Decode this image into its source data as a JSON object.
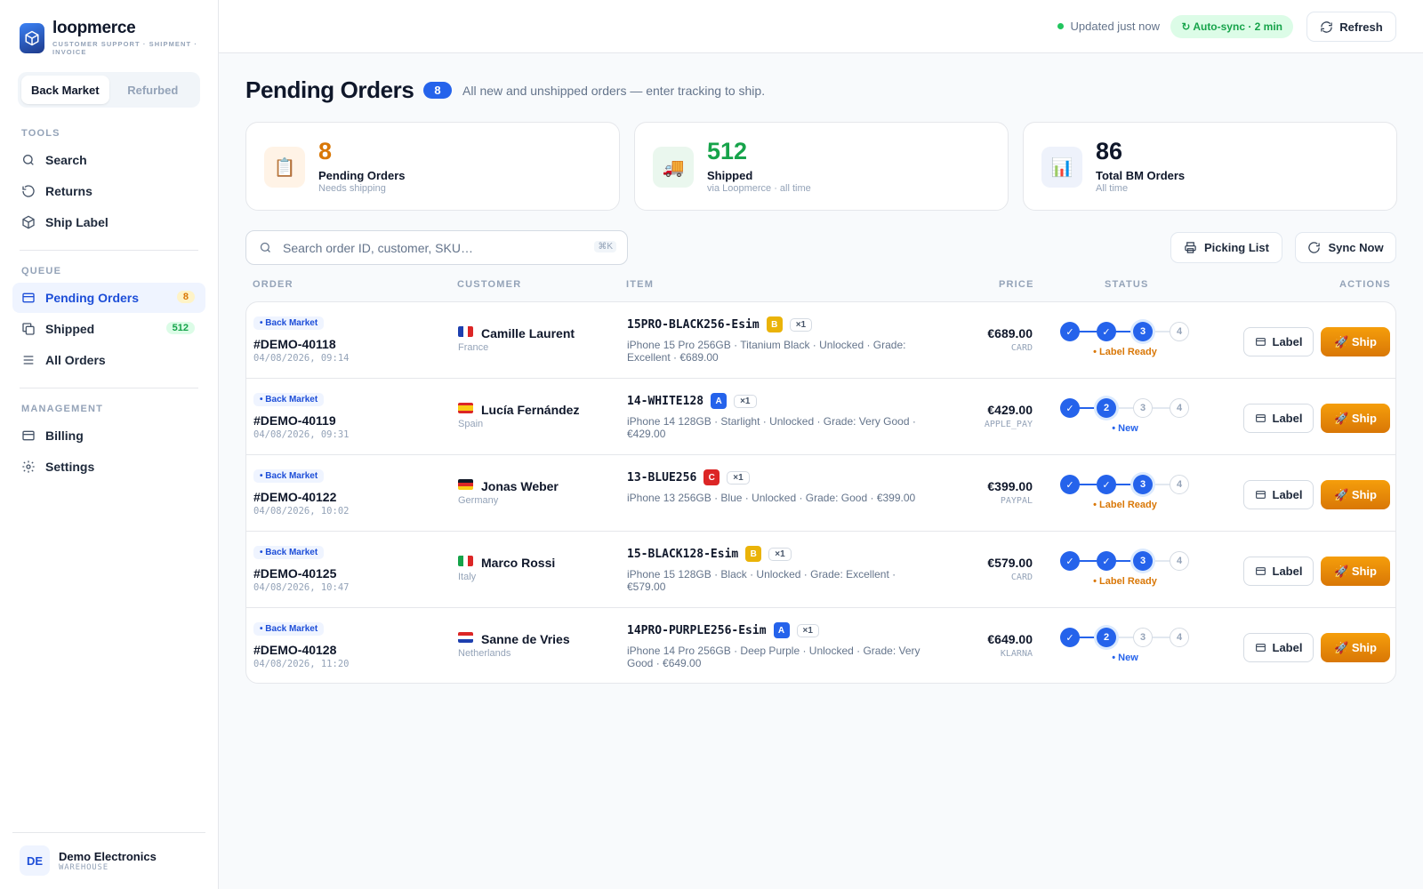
{
  "brand": {
    "name": "loopmerce",
    "subtitle": "CUSTOMER SUPPORT · SHIPMENT · INVOICE"
  },
  "marketplace_tabs": [
    {
      "label": "Back Market",
      "active": true
    },
    {
      "label": "Refurbed",
      "active": false
    }
  ],
  "sidebar": {
    "tools_heading": "TOOLS",
    "tools": [
      {
        "label": "Search",
        "icon": "search-icon"
      },
      {
        "label": "Returns",
        "icon": "returns-icon"
      },
      {
        "label": "Ship Label",
        "icon": "box-icon"
      }
    ],
    "queue_heading": "QUEUE",
    "queue": [
      {
        "label": "Pending Orders",
        "icon": "card-icon",
        "badge": "8",
        "active": true
      },
      {
        "label": "Shipped",
        "icon": "copy-icon",
        "badge": "512",
        "active": false
      },
      {
        "label": "All Orders",
        "icon": "list-icon",
        "badge": "",
        "active": false
      }
    ],
    "management_heading": "MANAGEMENT",
    "management": [
      {
        "label": "Billing",
        "icon": "billing-icon"
      },
      {
        "label": "Settings",
        "icon": "gear-icon"
      }
    ],
    "user": {
      "initials": "DE",
      "name": "Demo Electronics",
      "role": "WAREHOUSE"
    }
  },
  "topbar": {
    "updated": "Updated just now",
    "autosync": "↻ Auto-sync · 2 min",
    "refresh_label": "Refresh"
  },
  "page": {
    "title": "Pending Orders",
    "count": "8",
    "subtitle": "All new and unshipped orders — enter tracking to ship."
  },
  "stats": [
    {
      "value": "8",
      "label": "Pending Orders",
      "sub": "Needs shipping",
      "icon": "clipboard-icon",
      "glyph": "📋",
      "color": "#d97706",
      "bg": "#fff3e6"
    },
    {
      "value": "512",
      "label": "Shipped",
      "sub": "via Loopmerce · all time",
      "icon": "truck-icon",
      "glyph": "🚚",
      "color": "#16a34a",
      "bg": "#eaf7ee"
    },
    {
      "value": "86",
      "label": "Total BM Orders",
      "sub": "All time",
      "icon": "chart-icon",
      "glyph": "📊",
      "color": "#0f172a",
      "bg": "#eef2fb"
    }
  ],
  "search": {
    "placeholder": "Search order ID, customer, SKU…",
    "shortcut": "⌘K"
  },
  "toolbar": {
    "picking_list": "Picking List",
    "sync_now": "Sync Now"
  },
  "table": {
    "headers": {
      "order": "ORDER",
      "customer": "CUSTOMER",
      "item": "ITEM",
      "price": "PRICE",
      "status": "STATUS",
      "actions": "ACTIONS"
    },
    "label_btn": "Label",
    "ship_btn": "🚀 Ship",
    "rows": [
      {
        "market": "• Back Market",
        "id": "#DEMO-40118",
        "date": "04/08/2026, 09:14",
        "flag": "FR",
        "customer": "Camille Laurent",
        "country": "France",
        "sku": "15PRO-BLACK256-Esim",
        "grade": "B",
        "qty": "×1",
        "desc": "iPhone 15 Pro 256GB · Titanium Black · Unlocked · Grade: Excellent · €689.00",
        "price": "€689.00",
        "payment": "CARD",
        "step": 3,
        "status": "• Label Ready",
        "status_type": "orange"
      },
      {
        "market": "• Back Market",
        "id": "#DEMO-40119",
        "date": "04/08/2026, 09:31",
        "flag": "ES",
        "customer": "Lucía Fernández",
        "country": "Spain",
        "sku": "14-WHITE128",
        "grade": "A",
        "qty": "×1",
        "desc": "iPhone 14 128GB · Starlight · Unlocked · Grade: Very Good · €429.00",
        "price": "€429.00",
        "payment": "APPLE_PAY",
        "step": 2,
        "status": "• New",
        "status_type": "blue"
      },
      {
        "market": "• Back Market",
        "id": "#DEMO-40122",
        "date": "04/08/2026, 10:02",
        "flag": "DE",
        "customer": "Jonas Weber",
        "country": "Germany",
        "sku": "13-BLUE256",
        "grade": "C",
        "qty": "×1",
        "desc": "iPhone 13 256GB · Blue · Unlocked · Grade: Good · €399.00",
        "price": "€399.00",
        "payment": "PAYPAL",
        "step": 3,
        "status": "• Label Ready",
        "status_type": "orange"
      },
      {
        "market": "• Back Market",
        "id": "#DEMO-40125",
        "date": "04/08/2026, 10:47",
        "flag": "IT",
        "customer": "Marco Rossi",
        "country": "Italy",
        "sku": "15-BLACK128-Esim",
        "grade": "B",
        "qty": "×1",
        "desc": "iPhone 15 128GB · Black · Unlocked · Grade: Excellent · €579.00",
        "price": "€579.00",
        "payment": "CARD",
        "step": 3,
        "status": "• Label Ready",
        "status_type": "orange"
      },
      {
        "market": "• Back Market",
        "id": "#DEMO-40128",
        "date": "04/08/2026, 11:20",
        "flag": "NL",
        "customer": "Sanne de Vries",
        "country": "Netherlands",
        "sku": "14PRO-PURPLE256-Esim",
        "grade": "A",
        "qty": "×1",
        "desc": "iPhone 14 Pro 256GB · Deep Purple · Unlocked · Grade: Very Good · €649.00",
        "price": "€649.00",
        "payment": "KLARNA",
        "step": 2,
        "status": "• New",
        "status_type": "blue"
      }
    ]
  },
  "colors": {
    "accent": "#2563eb",
    "ship": "#f59e0b",
    "label_ready": "#d97706",
    "grade_A": "#2563eb",
    "grade_B": "#eab308",
    "grade_C": "#dc2626"
  }
}
